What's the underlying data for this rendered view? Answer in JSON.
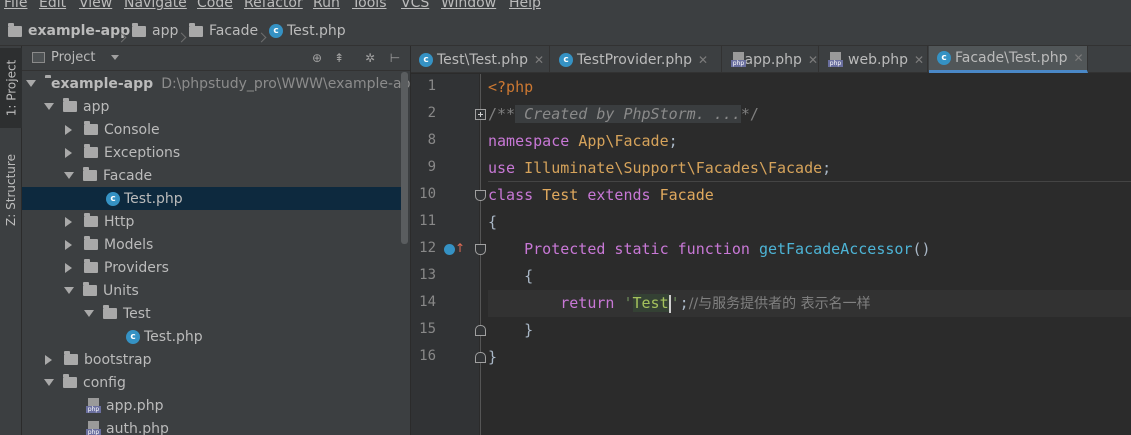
{
  "menu": [
    "File",
    "Edit",
    "View",
    "Navigate",
    "Code",
    "Refactor",
    "Run",
    "Tools",
    "VCS",
    "Window",
    "Help"
  ],
  "breadcrumb": [
    "example-app",
    "app",
    "Facade",
    "Test.php"
  ],
  "side_tabs": {
    "project": "1: Project",
    "structure": "Z: Structure"
  },
  "project_panel": {
    "title": "Project",
    "toolbar_icons": [
      "target-icon",
      "collapse-icon",
      "gear-icon",
      "hide-icon"
    ],
    "tree": [
      {
        "label": "example-app",
        "path": "D:\\phpstudy_pro\\WWW\\example-app",
        "type": "folder",
        "expanded": true,
        "depth": 0
      },
      {
        "label": "app",
        "type": "folder",
        "expanded": true,
        "depth": 1
      },
      {
        "label": "Console",
        "type": "folder",
        "expanded": false,
        "depth": 2
      },
      {
        "label": "Exceptions",
        "type": "folder",
        "expanded": false,
        "depth": 2
      },
      {
        "label": "Facade",
        "type": "folder",
        "expanded": true,
        "depth": 2
      },
      {
        "label": "Test.php",
        "type": "class",
        "depth": 3,
        "selected": true
      },
      {
        "label": "Http",
        "type": "folder",
        "expanded": false,
        "depth": 2
      },
      {
        "label": "Models",
        "type": "folder",
        "expanded": false,
        "depth": 2
      },
      {
        "label": "Providers",
        "type": "folder",
        "expanded": false,
        "depth": 2
      },
      {
        "label": "Units",
        "type": "folder",
        "expanded": true,
        "depth": 2
      },
      {
        "label": "Test",
        "type": "folder",
        "expanded": true,
        "depth": 3
      },
      {
        "label": "Test.php",
        "type": "class",
        "depth": 4
      },
      {
        "label": "bootstrap",
        "type": "folder",
        "expanded": false,
        "depth": 1
      },
      {
        "label": "config",
        "type": "folder",
        "expanded": true,
        "depth": 1
      },
      {
        "label": "app.php",
        "type": "php",
        "depth": 2
      },
      {
        "label": "auth.php",
        "type": "php",
        "depth": 2
      }
    ]
  },
  "tabs": [
    {
      "label": "Test\\Test.php",
      "icon": "class",
      "active": false
    },
    {
      "label": "TestProvider.php",
      "icon": "class",
      "active": false
    },
    {
      "label": "app.php",
      "icon": "php",
      "active": false
    },
    {
      "label": "web.php",
      "icon": "php",
      "active": false
    },
    {
      "label": "Facade\\Test.php",
      "icon": "class",
      "active": true
    }
  ],
  "line_numbers": [
    "1",
    "2",
    "8",
    "9",
    "10",
    "11",
    "12",
    "13",
    "14",
    "15",
    "16"
  ],
  "code": {
    "l1": "<?php",
    "l2_open": "/**",
    "l2_fold": " Created by PhpStorm. ...",
    "l2_close": "*/",
    "l8_kw": "namespace",
    "l8_a": "App",
    "l8_sep": "\\",
    "l8_b": "Facade",
    "l8_end": ";",
    "l9_kw": "use",
    "l9_a": "Illuminate",
    "l9_b": "Support",
    "l9_c": "Facades",
    "l9_d": "Facade",
    "l10_kw1": "class",
    "l10_name": "Test",
    "l10_kw2": "extends",
    "l10_parent": "Facade",
    "l11": "{",
    "l12_kw": "Protected static function",
    "l12_fn": "getFacadeAccessor",
    "l12_paren": "()",
    "l13": "{",
    "l14_kw": "return",
    "l14_q1": "'",
    "l14_str": "Test",
    "l14_q2": "'",
    "l14_semi": ";",
    "l14_cmt": "//与服务提供者的 表示名一样",
    "l15": "}",
    "l16": "}"
  },
  "colors": {
    "accent": "#4a88c7",
    "selection": "#0d293e",
    "keyword": "#cc7832",
    "string": "#6a8759"
  }
}
